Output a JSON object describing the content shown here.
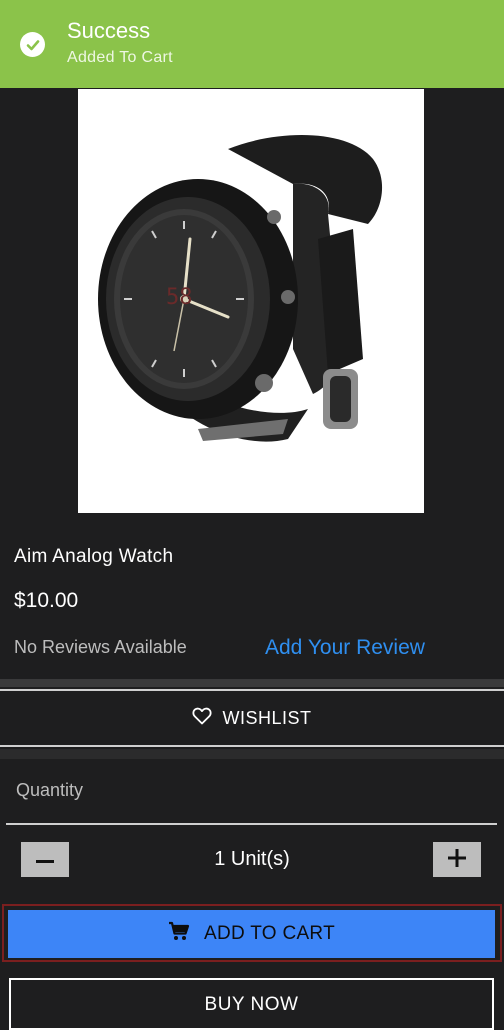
{
  "toast": {
    "title": "Success",
    "subtitle": "Added To Cart",
    "icon": "check-circle-icon",
    "color": "#8bc34a"
  },
  "product": {
    "image_alt": "watch-photo",
    "name": "Aim Analog Watch",
    "price": "$10.00",
    "reviews_text": "No Reviews Available",
    "add_review_label": "Add Your Review"
  },
  "wishlist": {
    "label": "WISHLIST",
    "icon": "heart-outline-icon"
  },
  "quantity": {
    "label": "Quantity",
    "value": "1 Unit(s)",
    "minus_icon": "minus-icon",
    "plus_icon": "plus-icon"
  },
  "actions": {
    "add_to_cart_label": "ADD TO CART",
    "add_to_cart_icon": "shopping-cart-icon",
    "add_to_cart_color": "#3d85f7",
    "buy_now_label": "BUY NOW"
  },
  "colors": {
    "background": "#1e1e1f",
    "link": "#2f8ff0"
  }
}
